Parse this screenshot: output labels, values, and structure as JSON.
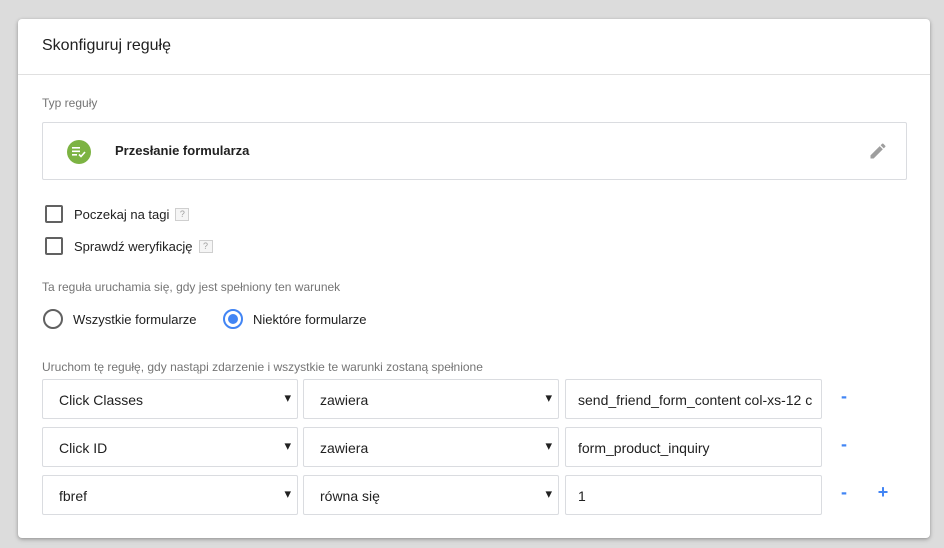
{
  "card": {
    "title": "Skonfiguruj regułę"
  },
  "rule_type": {
    "section_label": "Typ reguły",
    "name": "Przesłanie formularza",
    "icon": "form-submit-icon",
    "icon_color": "#7cb342"
  },
  "options": {
    "wait_for_tags": {
      "label": "Poczekaj na tagi",
      "help": "?",
      "checked": false
    },
    "check_validation": {
      "label": "Sprawdź weryfikację",
      "help": "?",
      "checked": false
    }
  },
  "fire_on": {
    "label": "Ta reguła uruchamia się, gdy jest spełniony ten warunek",
    "all_forms": {
      "label": "Wszystkie formularze",
      "selected": false
    },
    "some_forms": {
      "label": "Niektóre formularze",
      "selected": true
    }
  },
  "conditions": {
    "label": "Uruchom tę regułę, gdy nastąpi zdarzenie i wszystkie te warunki zostaną spełnione",
    "rows": [
      {
        "variable": "Click Classes",
        "operator": "zawiera",
        "value": "send_friend_form_content col-xs-12 c",
        "remove": "-"
      },
      {
        "variable": "Click ID",
        "operator": "zawiera",
        "value": "form_product_inquiry",
        "remove": "-"
      },
      {
        "variable": "fbref",
        "operator": "równa się",
        "value": "1",
        "remove": "-",
        "add": "+"
      }
    ]
  },
  "accent_color": "#4285f4"
}
